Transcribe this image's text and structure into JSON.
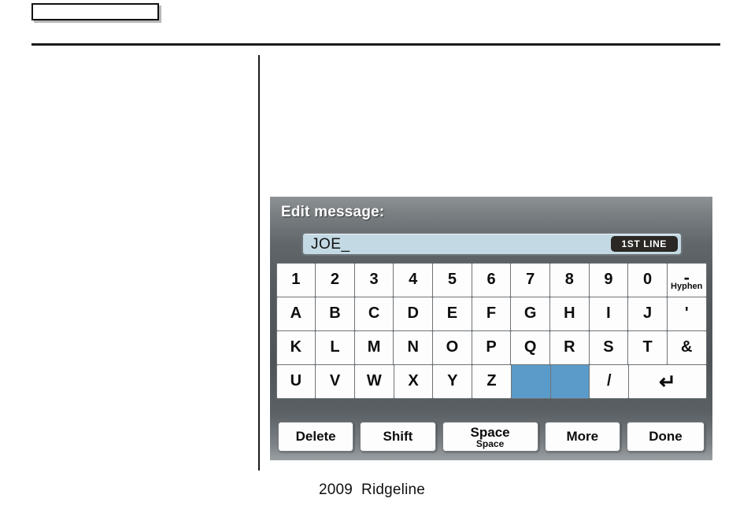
{
  "page": {
    "header_label": "",
    "footer_text": "2009  Ridgeline"
  },
  "screen": {
    "title": "Edit message:",
    "field": {
      "value": "JOE_",
      "placeholder": "",
      "line_badge": "1ST LINE",
      "field_color": "#c3d9e4"
    },
    "highlight_color": "#5a9bc9",
    "keyboard": {
      "rows": [
        [
          {
            "label": "1"
          },
          {
            "label": "2"
          },
          {
            "label": "3"
          },
          {
            "label": "4"
          },
          {
            "label": "5"
          },
          {
            "label": "6"
          },
          {
            "label": "7"
          },
          {
            "label": "8"
          },
          {
            "label": "9"
          },
          {
            "label": "0"
          },
          {
            "label": "-",
            "sub": "Hyphen",
            "name": "hyphen"
          }
        ],
        [
          {
            "label": "A"
          },
          {
            "label": "B"
          },
          {
            "label": "C"
          },
          {
            "label": "D"
          },
          {
            "label": "E"
          },
          {
            "label": "F"
          },
          {
            "label": "G"
          },
          {
            "label": "H"
          },
          {
            "label": "I"
          },
          {
            "label": "J"
          },
          {
            "label": "'",
            "name": "apostrophe"
          }
        ],
        [
          {
            "label": "K"
          },
          {
            "label": "L"
          },
          {
            "label": "M"
          },
          {
            "label": "N"
          },
          {
            "label": "O"
          },
          {
            "label": "P"
          },
          {
            "label": "Q"
          },
          {
            "label": "R"
          },
          {
            "label": "S"
          },
          {
            "label": "T"
          },
          {
            "label": "&",
            "name": "ampersand"
          }
        ],
        [
          {
            "label": "U"
          },
          {
            "label": "V"
          },
          {
            "label": "W"
          },
          {
            "label": "X"
          },
          {
            "label": "Y"
          },
          {
            "label": "Z"
          },
          {
            "label": "",
            "name": "blank-1",
            "state": "highlighted"
          },
          {
            "label": "",
            "name": "blank-2",
            "state": "highlighted"
          },
          {
            "label": "/",
            "name": "slash"
          },
          {
            "label": "↵",
            "name": "return",
            "width": 2
          }
        ]
      ]
    },
    "function_keys": [
      {
        "label": "Delete",
        "name": "delete"
      },
      {
        "label": "Shift",
        "name": "shift"
      },
      {
        "label": "Space",
        "sub": "Space",
        "name": "space"
      },
      {
        "label": "More",
        "name": "more"
      },
      {
        "label": "Done",
        "name": "done"
      }
    ]
  }
}
